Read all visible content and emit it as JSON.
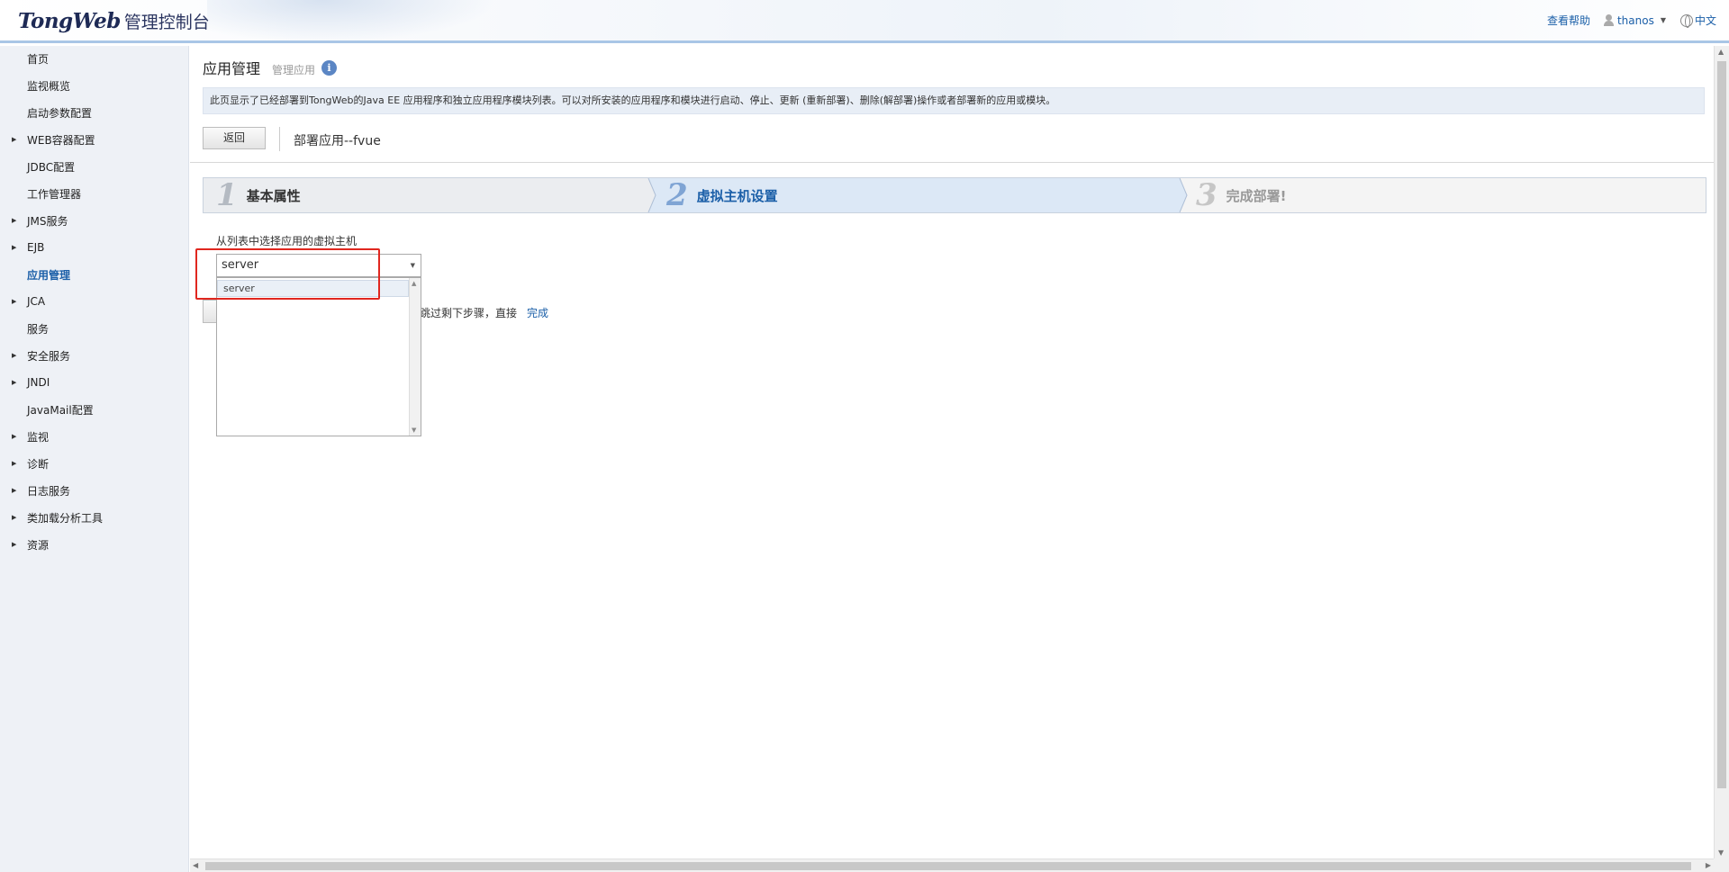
{
  "header": {
    "logo_brand": "TongWeb",
    "logo_sub": "管理控制台",
    "help_link": "查看帮助",
    "user_name": "thanos",
    "language": "中文"
  },
  "sidebar": {
    "items": [
      {
        "label": "首页",
        "expandable": false,
        "active": false
      },
      {
        "label": "监视概览",
        "expandable": false,
        "active": false
      },
      {
        "label": "启动参数配置",
        "expandable": false,
        "active": false
      },
      {
        "label": "WEB容器配置",
        "expandable": true,
        "active": false
      },
      {
        "label": "JDBC配置",
        "expandable": false,
        "active": false
      },
      {
        "label": "工作管理器",
        "expandable": false,
        "active": false
      },
      {
        "label": "JMS服务",
        "expandable": true,
        "active": false
      },
      {
        "label": "EJB",
        "expandable": true,
        "active": false
      },
      {
        "label": "应用管理",
        "expandable": false,
        "active": true
      },
      {
        "label": "JCA",
        "expandable": true,
        "active": false
      },
      {
        "label": "服务",
        "expandable": false,
        "active": false
      },
      {
        "label": "安全服务",
        "expandable": true,
        "active": false
      },
      {
        "label": "JNDI",
        "expandable": true,
        "active": false
      },
      {
        "label": "JavaMail配置",
        "expandable": false,
        "active": false
      },
      {
        "label": "监视",
        "expandable": true,
        "active": false
      },
      {
        "label": "诊断",
        "expandable": true,
        "active": false
      },
      {
        "label": "日志服务",
        "expandable": true,
        "active": false
      },
      {
        "label": "类加载分析工具",
        "expandable": true,
        "active": false
      },
      {
        "label": "资源",
        "expandable": true,
        "active": false
      }
    ]
  },
  "main": {
    "title": "应用管理",
    "subtitle": "管理应用",
    "info_icon": "i",
    "description": "此页显示了已经部署到TongWeb的Java EE 应用程序和独立应用程序模块列表。可以对所安装的应用程序和模块进行启动、停止、更新 (重新部署)、删除(解部署)操作或者部署新的应用或模块。",
    "back_button": "返回",
    "deploy_title": "部署应用--fvue",
    "steps": [
      {
        "number": "1",
        "label": "基本属性",
        "state": "done"
      },
      {
        "number": "2",
        "label": "虚拟主机设置",
        "state": "current"
      },
      {
        "number": "3",
        "label": "完成部署!",
        "state": "pending"
      }
    ],
    "vhost_label": "从列表中选择应用的虚拟主机",
    "vhost_selected": "server",
    "vhost_options": [
      "server"
    ],
    "skip_text": "跳过剩下步骤，直接",
    "finish_link": "完成"
  },
  "colors": {
    "accent": "#1b5fa8",
    "highlight": "#e0271f",
    "sidebar_bg": "#eef1f6",
    "step_current_bg": "#dce8f6"
  }
}
